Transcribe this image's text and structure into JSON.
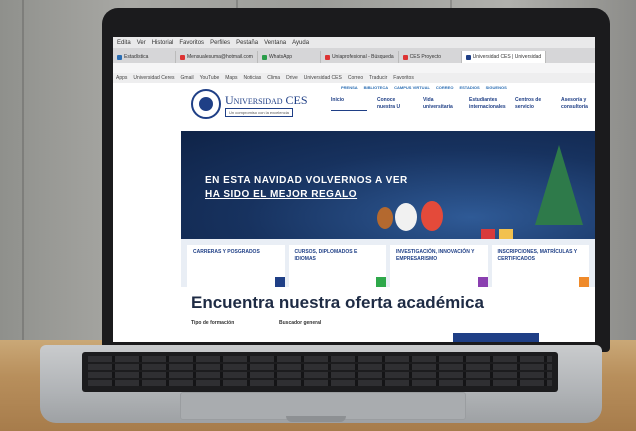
{
  "browser": {
    "menu": [
      "Edita",
      "Ver",
      "Historial",
      "Favoritos",
      "Perfiles",
      "Pestaña",
      "Ventana",
      "Ayuda"
    ],
    "tabs": [
      {
        "label": "Estadística",
        "color": "#2a6db3",
        "active": false
      },
      {
        "label": "Mensualesuma@hotmail.com",
        "color": "#d33",
        "active": false
      },
      {
        "label": "WhatsApp",
        "color": "#2a9d4a",
        "active": false
      },
      {
        "label": "Uniaprofesional - Búsqueda",
        "color": "#d33",
        "active": false
      },
      {
        "label": "CES Proyecto",
        "color": "#d33",
        "active": false
      },
      {
        "label": "Universidad CES | Universidad",
        "color": "#1f3f86",
        "active": true
      }
    ],
    "bookmarks": [
      "Apps",
      "Universidad Ceres",
      "Gmail",
      "YouTube",
      "Maps",
      "Noticias",
      "Clima",
      "Drive",
      "Universidad CES",
      "Correo",
      "Traducir",
      "Favoritos"
    ]
  },
  "site": {
    "logo_name": "Universidad CES",
    "logo_tagline": "Un compromiso con la excelencia",
    "top_nav": [
      "PRENSA",
      "BIBLIOTECA",
      "CAMPUS VIRTUAL",
      "CORREO",
      "ESTADIOS",
      "SIGUENOS"
    ],
    "main_nav": [
      "Inicio",
      "Conoce nuestra U",
      "Vida universitaria",
      "Estudiantes internacionales",
      "Centros de servicio",
      "Asesoría y consultoría"
    ],
    "hero_line1": "EN ESTA NAVIDAD VOLVERNOS A VER",
    "hero_line2": "HA SIDO EL MEJOR REGALO",
    "cards": [
      {
        "label": "CARRERAS Y POSGRADOS",
        "color": "#1f3f86"
      },
      {
        "label": "CURSOS, DIPLOMADOS E IDIOMAS",
        "color": "#2ea84a"
      },
      {
        "label": "INVESTIGACIÓN, INNOVACIÓN Y EMPRESARISMO",
        "color": "#8a3fb0"
      },
      {
        "label": "INSCRIPCIONES, MATRÍCULAS Y CERTIFICADOS",
        "color": "#ef8a2a"
      }
    ],
    "oferta_title": "Encuentra nuestra oferta académica",
    "filter_type_label": "Tipo de formación",
    "filter_search_label": "Buscador general"
  }
}
